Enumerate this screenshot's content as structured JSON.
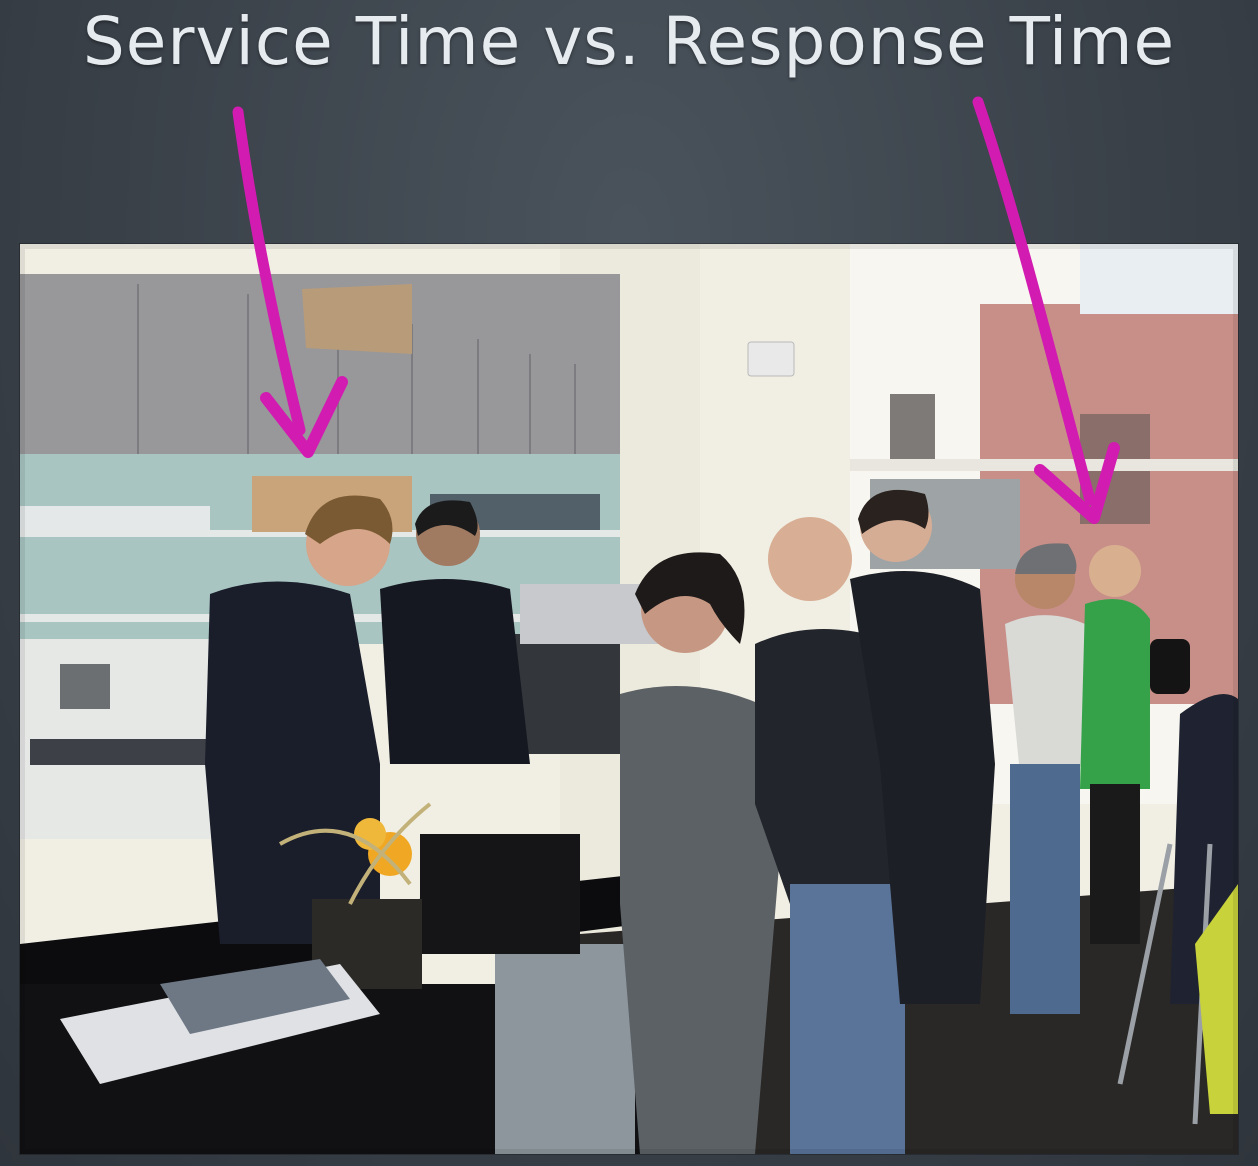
{
  "slide": {
    "title": "Service Time vs. Response Time"
  },
  "photo": {
    "subject": "coffee-shop-counter-with-queue"
  },
  "arrows": {
    "color": "#d21bb0",
    "service_arrow_icon": "arrow-down-icon",
    "response_arrow_icon": "arrow-down-icon"
  }
}
